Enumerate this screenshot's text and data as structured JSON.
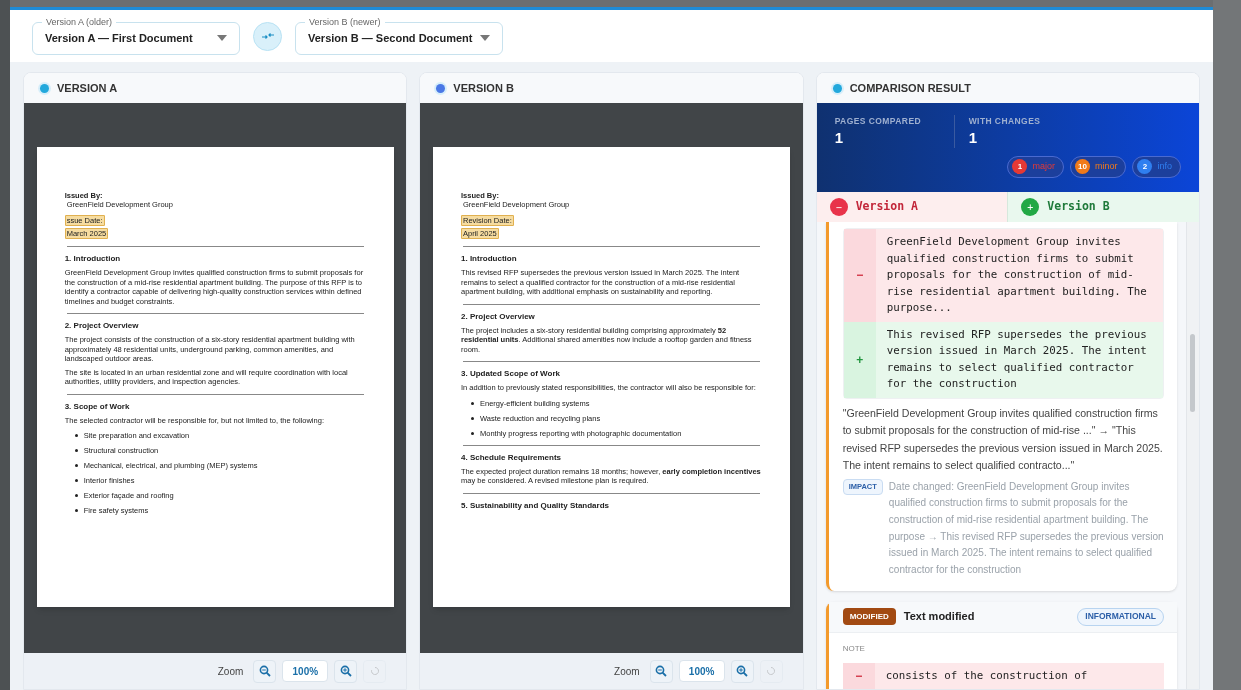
{
  "selectors": [
    {
      "label": "Version A (older)",
      "value": "Version A — First Document"
    },
    {
      "label": "Version B (newer)",
      "value": "Version B — Second Document"
    }
  ],
  "documents": [
    {
      "title": "VERSION A",
      "color": "#22a8dc",
      "zoom": {
        "label": "Zoom",
        "value": "100%",
        "reset_disabled": true
      },
      "blocks": [
        {
          "kind": "meta",
          "text": "Issued By:"
        },
        {
          "kind": "line",
          "text": "GreenField Development Group"
        },
        {
          "kind": "date",
          "text": "ssue Date:"
        },
        {
          "kind": "date",
          "text": "March 2025"
        },
        {
          "kind": "rule"
        },
        {
          "kind": "heading",
          "text": "1. Introduction"
        },
        {
          "kind": "paragraph",
          "text": "GreenField Development Group invites qualified construction firms to submit proposals for the construction of a mid-rise residential apartment building. The purpose of this RFP is to identify a contractor capable of delivering high-quality construction services within defined timelines and budget constraints."
        },
        {
          "kind": "rule"
        },
        {
          "kind": "heading",
          "text": "2. Project Overview"
        },
        {
          "kind": "paragraph",
          "text": "The project consists of the construction of a six-story residential apartment building with approximately 48 residential units, underground parking, common amenities, and landscaped outdoor areas."
        },
        {
          "kind": "paragraph",
          "text": "The site is located in an urban residential zone and will require coordination with local authorities, utility providers, and inspection agencies."
        },
        {
          "kind": "rule"
        },
        {
          "kind": "heading",
          "text": "3. Scope of Work"
        },
        {
          "kind": "paragraph",
          "text": "The selected contractor will be responsible for, but not limited to, the following:"
        },
        {
          "kind": "bullet",
          "text": "Site preparation and excavation"
        },
        {
          "kind": "bullet",
          "text": "Structural construction"
        },
        {
          "kind": "bullet",
          "text": "Mechanical, electrical, and plumbing (MEP) systems"
        },
        {
          "kind": "bullet",
          "text": "Interior finishes"
        },
        {
          "kind": "bullet",
          "text": "Exterior façade and roofing"
        },
        {
          "kind": "bullet",
          "text": "Fire safety systems"
        }
      ]
    },
    {
      "title": "VERSION B",
      "color": "#4a78e6",
      "zoom": {
        "label": "Zoom",
        "value": "100%",
        "reset_disabled": true
      },
      "blocks": [
        {
          "kind": "meta",
          "text": "Issued By:"
        },
        {
          "kind": "line",
          "text": "GreenField Development Group"
        },
        {
          "kind": "date",
          "text": "Revision Date:"
        },
        {
          "kind": "date",
          "text": "April 2025"
        },
        {
          "kind": "rule"
        },
        {
          "kind": "heading",
          "text": "1. Introduction"
        },
        {
          "kind": "paragraph",
          "text": "This revised RFP supersedes the previous version issued in March 2025. The intent remains to select a qualified contractor for the construction of a mid-rise residential apartment building, with additional emphasis on sustainability and reporting."
        },
        {
          "kind": "rule"
        },
        {
          "kind": "heading",
          "text": "2. Project Overview"
        },
        {
          "kind": "paragraph",
          "text": "The project includes a six-story residential building comprising approximately **52 residential units**. Additional shared amenities now include a rooftop garden and fitness room."
        },
        {
          "kind": "rule"
        },
        {
          "kind": "heading",
          "text": "3. Updated Scope of Work"
        },
        {
          "kind": "paragraph",
          "text": "In addition to previously stated responsibilities, the contractor will also be responsible for:"
        },
        {
          "kind": "bullet",
          "text": "Energy-efficient building systems"
        },
        {
          "kind": "bullet",
          "text": "Waste reduction and recycling plans"
        },
        {
          "kind": "bullet",
          "text": "Monthly progress reporting with photographic documentation"
        },
        {
          "kind": "rule"
        },
        {
          "kind": "heading",
          "text": "4. Schedule Requirements"
        },
        {
          "kind": "paragraph",
          "text": "The expected project duration remains 18 months; however, **early completion incentives** may be considered. A revised milestone plan is required."
        },
        {
          "kind": "rule"
        },
        {
          "kind": "heading",
          "text": "5. Sustainability and Quality Standards"
        }
      ]
    }
  ],
  "result": {
    "title": "COMPARISON RESULT",
    "color": "#22a8dc",
    "stats": [
      {
        "label": "PAGES COMPARED",
        "value": "1"
      },
      {
        "label": "WITH CHANGES",
        "value": "1"
      }
    ],
    "badges": [
      {
        "count": "1",
        "label": "major",
        "color": "#e53935"
      },
      {
        "count": "10",
        "label": "minor",
        "color": "#f07a1a"
      },
      {
        "count": "2",
        "label": "info",
        "color": "#2f7ff0"
      }
    ],
    "versions": [
      {
        "kind": "removed",
        "sign": "−",
        "label": "Version A"
      },
      {
        "kind": "added",
        "sign": "+",
        "label": "Version B"
      }
    ],
    "changes": [
      {
        "diff": [
          {
            "kind": "removed",
            "sign": "−",
            "text": "GreenField Development Group invites qualified construction firms to submit proposals for the construction of mid-rise residential apartment building. The purpose..."
          },
          {
            "kind": "added",
            "sign": "+",
            "text": "This revised RFP supersedes the previous version issued in March 2025. The intent remains to select qualified contractor for the construction"
          }
        ],
        "summary": "\"GreenField Development Group invites qualified construction firms to submit proposals for the construction of mid-rise ...\" → \"This revised RFP supersedes the previous version issued in March 2025. The intent remains to select qualified contracto...\"",
        "impact_label": "IMPACT",
        "impact": "Date changed: GreenField Development Group invites qualified construction firms to submit proposals for the construction of mid-rise residential apartment building. The purpose → This revised RFP supersedes the previous version issued in March 2025. The intent remains to select qualified contractor for the construction"
      },
      {
        "tag": "MODIFIED",
        "title": "Text modified",
        "severity": "INFORMATIONAL",
        "note_label": "NOTE",
        "diff": [
          {
            "kind": "removed",
            "sign": "−",
            "text": "consists of the construction of"
          }
        ]
      }
    ]
  }
}
